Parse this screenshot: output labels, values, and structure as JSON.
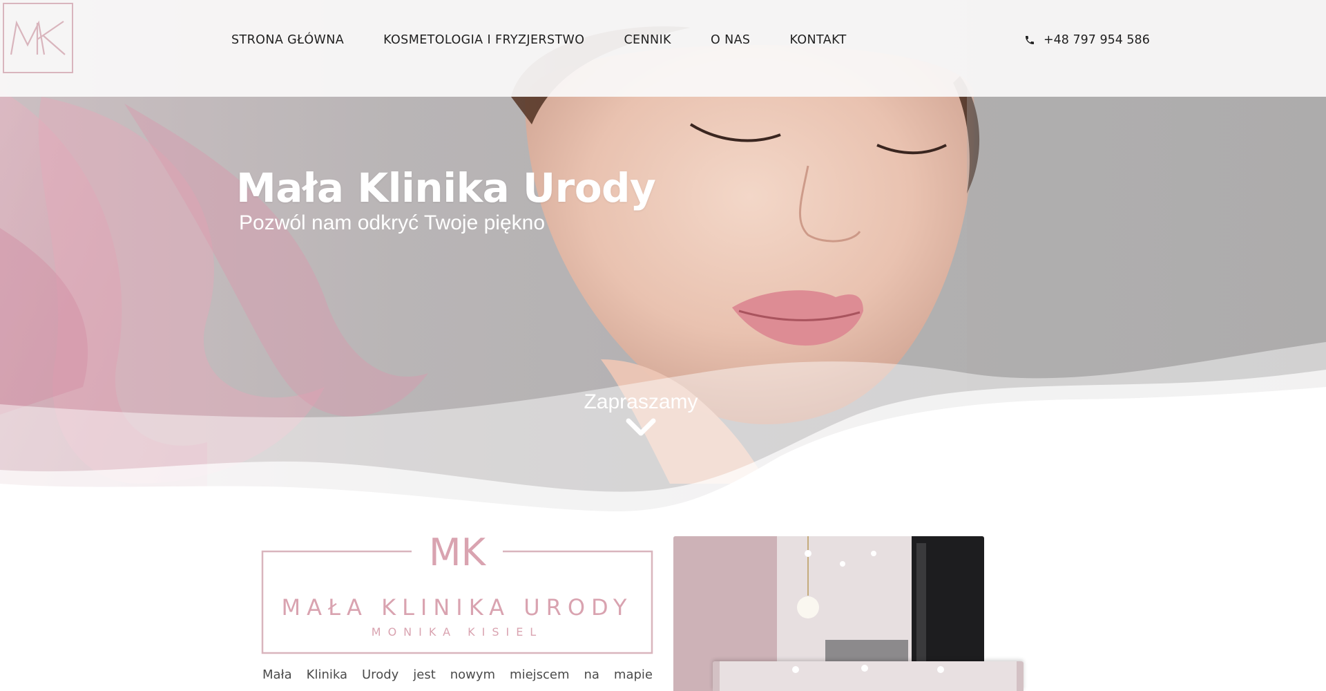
{
  "header": {
    "logo_text": "MK",
    "nav": [
      {
        "label": "STRONA GŁÓWNA"
      },
      {
        "label": "KOSMETOLOGIA I FRYZJERSTWO"
      },
      {
        "label": "CENNIK"
      },
      {
        "label": "O NAS"
      },
      {
        "label": "KONTAKT"
      }
    ],
    "phone": "+48 797 954 586",
    "phone_icon": "phone-icon"
  },
  "hero": {
    "title": "Mała Klinika Urody",
    "subtitle": "Pozwól nam odkryć Twoje piękno",
    "cta_label": "Zapraszamy",
    "cta_icon": "chevron-down-icon"
  },
  "about": {
    "logo_monogram": "MK",
    "logo_name": "MAŁA KLINIKA URODY",
    "logo_owner": "MONIKA KISIEL",
    "text": "Mała Klinika Urody jest nowym miejscem na mapie"
  },
  "colors": {
    "accent_pink": "#d9b5bd",
    "text_dark": "#1f1f1f",
    "hero_text": "#ffffff"
  }
}
